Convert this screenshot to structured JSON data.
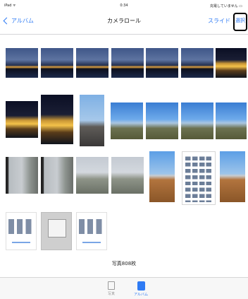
{
  "status_bar": {
    "carrier": "iPad ᯤ",
    "time": "0:34",
    "battery": "充電していません ▭"
  },
  "nav": {
    "back_label": "アルバム",
    "title": "カメラロール",
    "slideshow_label": "スライド",
    "select_label": "選択"
  },
  "photos": [
    {
      "kind": "night"
    },
    {
      "kind": "night"
    },
    {
      "kind": "night"
    },
    {
      "kind": "night"
    },
    {
      "kind": "night"
    },
    {
      "kind": "night"
    },
    {
      "kind": "parl"
    },
    {
      "kind": "parl"
    },
    {
      "kind": "parl"
    },
    {
      "kind": "tower"
    },
    {
      "kind": "sky"
    },
    {
      "kind": "sky"
    },
    {
      "kind": "sky"
    },
    {
      "kind": "sky"
    },
    {
      "kind": "window"
    },
    {
      "kind": "window"
    },
    {
      "kind": "city"
    },
    {
      "kind": "city"
    },
    {
      "kind": "rooftop"
    },
    {
      "kind": "grid-screen"
    },
    {
      "kind": "rooftop"
    },
    {
      "kind": "shot"
    },
    {
      "kind": "shot-gray"
    },
    {
      "kind": "shot"
    }
  ],
  "footer": {
    "photo_count": "写真808枚"
  },
  "tabs": {
    "photos_label": "写真",
    "albums_label": "アルバム"
  },
  "colors": {
    "accent": "#2f7bf4",
    "background": "#ffffff",
    "tabbar": "#f7f7f7"
  }
}
